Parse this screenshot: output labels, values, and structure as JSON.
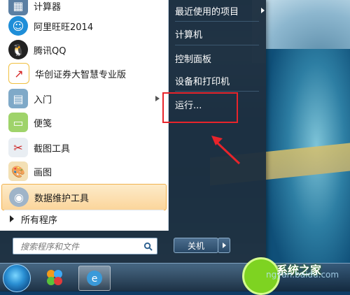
{
  "start_menu": {
    "left_items": [
      {
        "label": "计算器",
        "icon": "calculator-icon"
      },
      {
        "label": "阿里旺旺2014",
        "icon": "aliwangwang-icon"
      },
      {
        "label": "腾讯QQ",
        "icon": "qq-penguin-icon"
      },
      {
        "label": "华创证券大智慧专业版",
        "icon": "stock-chart-icon"
      },
      {
        "label": "入门",
        "icon": "getting-started-icon",
        "has_submenu": true
      },
      {
        "label": "便笺",
        "icon": "sticky-notes-icon"
      },
      {
        "label": "截图工具",
        "icon": "scissors-icon"
      },
      {
        "label": "画图",
        "icon": "paint-palette-icon"
      },
      {
        "label": "数据维护工具",
        "icon": "data-disk-icon",
        "highlighted": true
      }
    ],
    "all_programs": "所有程序",
    "search_placeholder": "搜索程序和文件",
    "right_items": [
      {
        "label": "最近使用的项目",
        "has_submenu": true
      },
      {
        "label": "计算机"
      },
      {
        "label": "控制面板"
      },
      {
        "label": "设备和打印机"
      },
      {
        "label": "运行..."
      }
    ],
    "shutdown_label": "关机"
  },
  "watermark": {
    "text": "系统之家",
    "url": "ngyan.baidu.com"
  },
  "colors": {
    "highlight_box": "#e8242b",
    "menu_bg": "#1c2e3e",
    "selected_item": "#fbd59b"
  }
}
